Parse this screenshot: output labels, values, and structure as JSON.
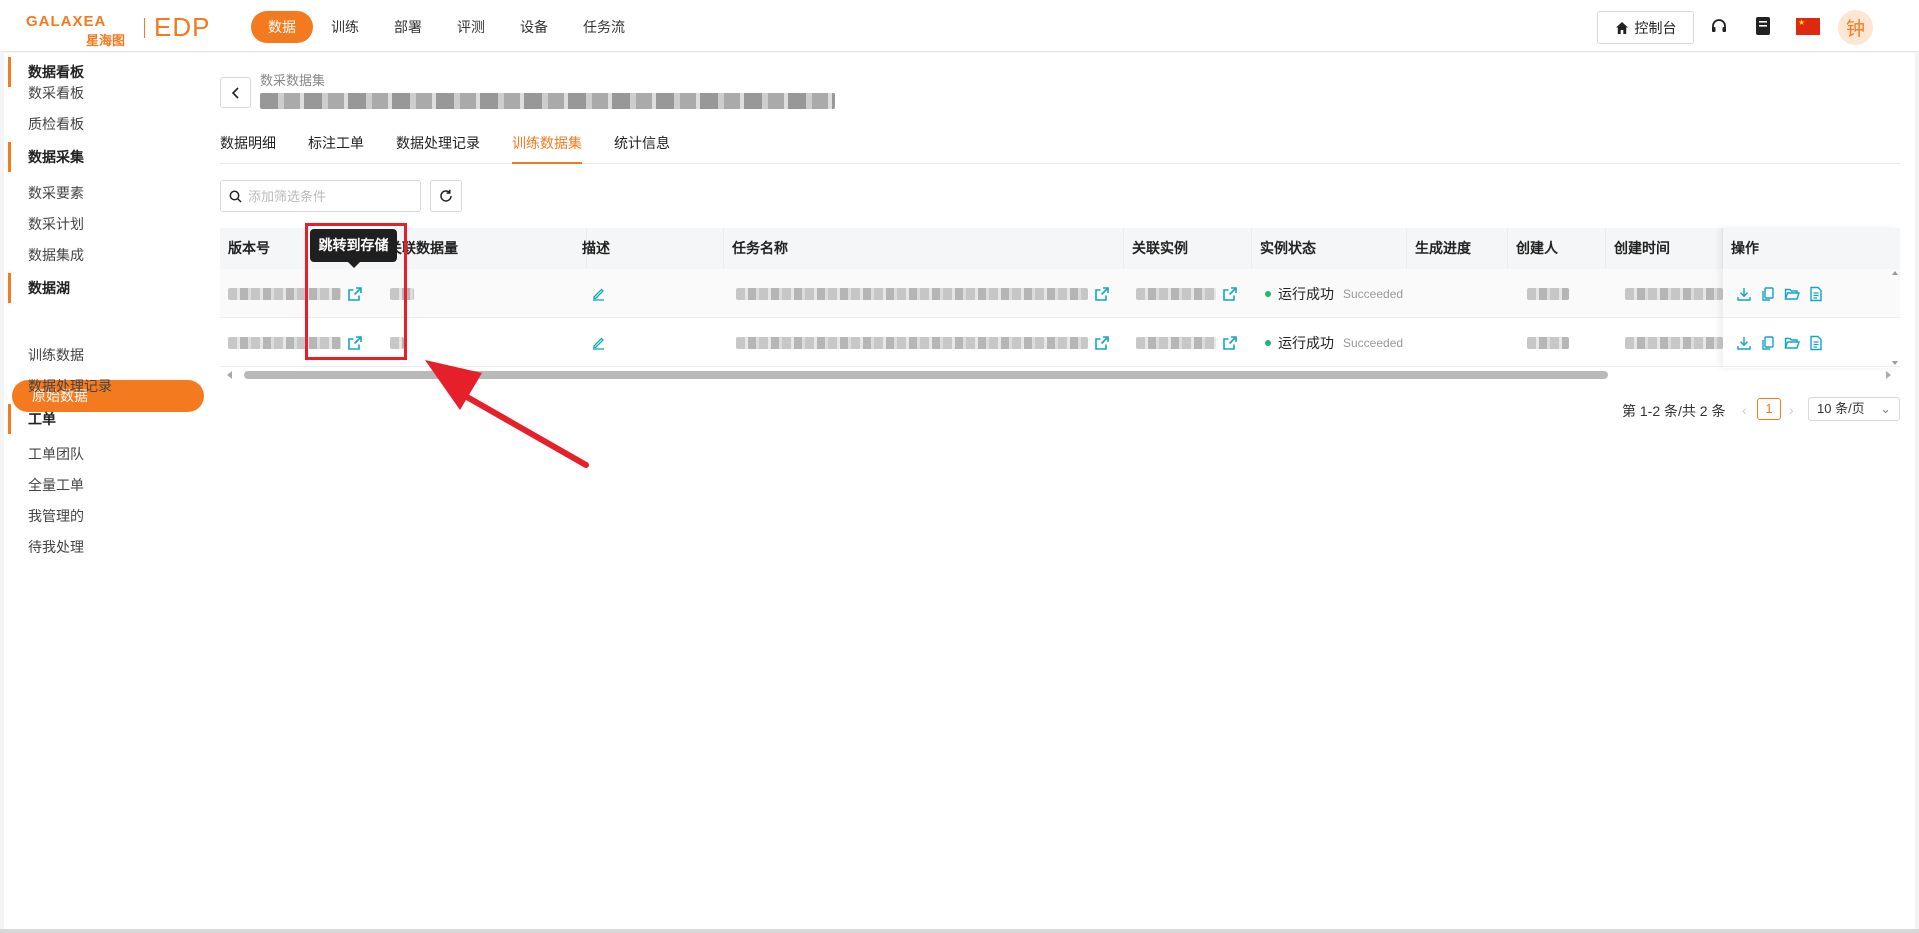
{
  "brand": {
    "logo_top": "GALAXEA",
    "logo_cn": "星海图",
    "logo_edp": "EDP",
    "accent": "#f47a1f"
  },
  "nav": {
    "items": [
      "数据",
      "训练",
      "部署",
      "评测",
      "设备",
      "任务流"
    ],
    "active_index": 0
  },
  "header": {
    "console_label": "控制台",
    "avatar_text": "钟"
  },
  "sidebar": {
    "groups": [
      {
        "title": "数据看板",
        "items": [
          "数采看板",
          "质检看板"
        ]
      },
      {
        "title": "数据采集",
        "items": [
          "数采要素",
          "数采计划",
          "数据集成"
        ]
      },
      {
        "title": "数据湖",
        "items": [
          "原始数据",
          "训练数据",
          "数据处理记录"
        ]
      },
      {
        "title": "工单",
        "items": [
          "工单团队",
          "全量工单",
          "我管理的",
          "待我处理"
        ]
      }
    ],
    "active_item": "原始数据"
  },
  "page": {
    "breadcrumb": "数采数据集",
    "tabs": [
      "数据明细",
      "标注工单",
      "数据处理记录",
      "训练数据集",
      "统计信息"
    ],
    "active_tab_index": 3,
    "filter_placeholder": "添加筛选条件"
  },
  "table": {
    "columns": [
      "版本号",
      "关联数据量",
      "描述",
      "任务名称",
      "关联实例",
      "实例状态",
      "生成进度",
      "创建人",
      "创建时间",
      "操作"
    ],
    "rows": [
      {
        "status_cn": "运行成功",
        "status_en": "Succeeded"
      },
      {
        "status_cn": "运行成功",
        "status_en": "Succeeded"
      }
    ],
    "status_color": "#19b96e"
  },
  "tooltip": {
    "text": "跳转到存储"
  },
  "pagination": {
    "total_text": "第 1-2 条/共 2 条",
    "current_page": "1",
    "page_size": "10 条/页"
  }
}
